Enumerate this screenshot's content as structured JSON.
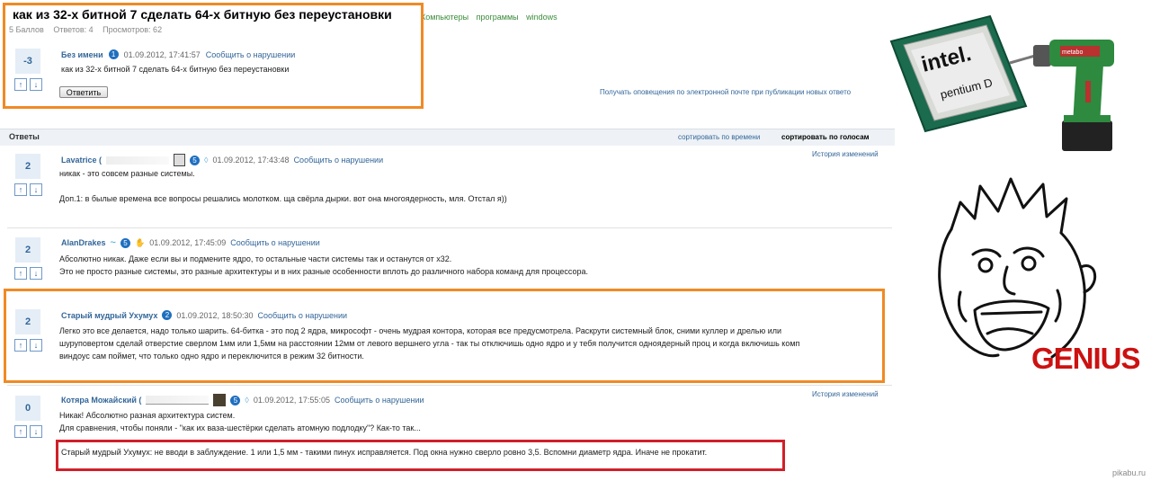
{
  "question": {
    "title": "как из 32-х битной 7 сделать 64-х битную без переустановки",
    "tags": [
      "Компьютеры",
      "программы",
      "windows"
    ],
    "stats": {
      "points": "5 Баллов",
      "answers": "Ответов: 4",
      "views": "Просмотров: 62"
    },
    "score": "-3",
    "author": "Без имени",
    "level": "1",
    "date": "01.09.2012, 17:41:57",
    "report": "Сообщить о нарушении",
    "text": "как из 32-х битной 7 сделать 64-х битную без переустановки",
    "reply_label": "Ответить",
    "notify": "Получать оповещения по электронной почте при публикации новых ответо"
  },
  "answers_header": {
    "label": "Ответы",
    "sort_time": "сортировать по времени",
    "sort_votes": "сортировать по голосам"
  },
  "answers": [
    {
      "score": "2",
      "author": "Lavatrice (",
      "level": "5",
      "date": "01.09.2012, 17:43:48",
      "report": "Сообщить о нарушении",
      "history": "История изменений",
      "lines": [
        "никак - это совсем разные системы.",
        "",
        "Доп.1: в былые времена все вопросы решались молотком. ща свёрла дырки. вот она многоядерность, мля. Отстал я))"
      ]
    },
    {
      "score": "2",
      "author": "AlanDrakes",
      "level": "5",
      "date": "01.09.2012, 17:45:09",
      "report": "Сообщить о нарушении",
      "lines": [
        "Абсолютно никак. Даже если вы и подмените ядро, то остальные части системы так и останутся от x32.",
        "Это не просто разные системы, это разные архитектуры и в них разные особенности вплоть до различного набора команд для процессора."
      ]
    },
    {
      "score": "2",
      "author": "Старый мудрый Ухумух",
      "level": "2",
      "date": "01.09.2012, 18:50:30",
      "report": "Сообщить о нарушении",
      "lines": [
        "Легко это все делается, надо только шарить. 64-битка - это под 2 ядра, микрософт - очень мудрая контора, которая все предусмотрела. Раскрути системный блок, сними куллер и дрелью или",
        "шуруповертом сделай отверстие сверлом 1мм или 1,5мм на расстоянии 12мм от левого вершнего угла - так ты отключишь одно ядро и у тебя получится одноядерный проц и когда включишь комп",
        "виндоус сам поймет, что только одно ядро и переключится в режим 32 битности."
      ]
    },
    {
      "score": "0",
      "author": "Котяра Можайский (",
      "level": "5",
      "date": "01.09.2012, 17:55:05",
      "report": "Сообщить о нарушении",
      "history": "История изменений",
      "lines": [
        "Никак! Абсолютно разная архитектура систем.",
        "Для сравнения, чтобы поняли - \"как их ваза-шестёрки сделать атомную подлодку\"? Как-то так..."
      ],
      "comment": "Старый мудрый Ухумух: не вводи в заблуждение. 1 или 1,5 мм - такими пинух исправляется. Под окна нужно сверло ровно 3,5. Вспомни диаметр ядра. Иначе не прокатит."
    }
  ],
  "meme": {
    "cpu_brand": "intel.",
    "cpu_model": "pentium D",
    "drill_brand": "metabo",
    "genius": "GENIUS"
  },
  "watermark": "pikabu.ru",
  "colors": {
    "highlight": "#f08a24",
    "comment_box": "#d0202a",
    "link": "#336699",
    "genius": "#cc1111"
  }
}
